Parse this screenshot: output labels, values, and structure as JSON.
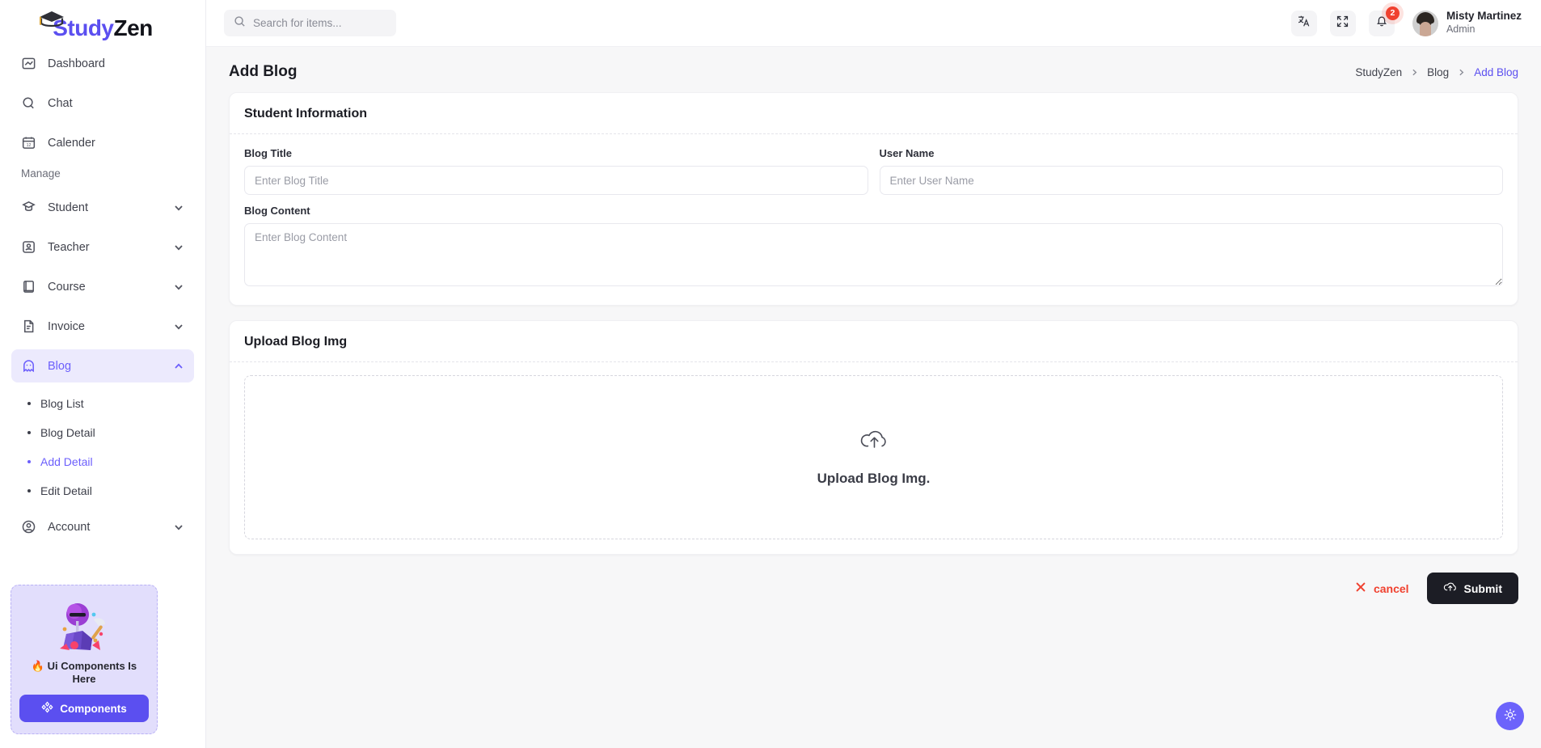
{
  "brand": {
    "part1": "Study",
    "part2": "Zen",
    "icon": "graduation-cap-icon"
  },
  "sidebar": {
    "items": [
      {
        "label": "Dashboard",
        "icon": "dashboard-icon",
        "expandable": false
      },
      {
        "label": "Chat",
        "icon": "chat-icon",
        "expandable": false
      },
      {
        "label": "Calender",
        "icon": "calendar-icon",
        "expandable": false
      }
    ],
    "section_label": "Manage",
    "manage_items": [
      {
        "label": "Student",
        "icon": "student-icon",
        "expandable": true
      },
      {
        "label": "Teacher",
        "icon": "teacher-icon",
        "expandable": true
      },
      {
        "label": "Course",
        "icon": "course-icon",
        "expandable": true
      },
      {
        "label": "Invoice",
        "icon": "invoice-icon",
        "expandable": true
      },
      {
        "label": "Blog",
        "icon": "ghost-icon",
        "expandable": true,
        "active": true,
        "expanded": true
      }
    ],
    "blog_children": [
      {
        "label": "Blog List"
      },
      {
        "label": "Blog Detail"
      },
      {
        "label": "Add Detail",
        "active": true
      },
      {
        "label": "Edit Detail"
      }
    ],
    "account_item": {
      "label": "Account",
      "icon": "account-circle-icon",
      "expandable": true
    },
    "promo": {
      "title": "🔥 Ui Components Is Here",
      "button_label": "Components",
      "button_icon": "components-icon",
      "art": "pickaxe-mining-illustration"
    }
  },
  "topbar": {
    "search": {
      "placeholder": "Search for items...",
      "value": "",
      "icon": "search-icon"
    },
    "language_icon": "translate-icon",
    "fullscreen_icon": "fullscreen-icon",
    "notification_icon": "bell-icon",
    "notification_count": "2",
    "user": {
      "name": "Misty Martinez",
      "role": "Admin",
      "avatar": "user-avatar"
    }
  },
  "page": {
    "title": "Add Blog",
    "breadcrumb": [
      {
        "label": "StudyZen",
        "current": false
      },
      {
        "label": "Blog",
        "current": false
      },
      {
        "label": "Add Blog",
        "current": true
      }
    ]
  },
  "student_information": {
    "card_title": "Student Information",
    "fields": [
      {
        "label": "Blog Title",
        "placeholder": "Enter Blog Title",
        "value": ""
      },
      {
        "label": "User Name",
        "placeholder": "Enter User Name",
        "value": ""
      }
    ],
    "content_field": {
      "label": "Blog Content",
      "placeholder": "Enter Blog Content",
      "value": ""
    }
  },
  "upload": {
    "card_title": "Upload Blog Img",
    "dropzone_label": "Upload Blog Img.",
    "dropzone_icon": "cloud-upload-icon"
  },
  "actions": {
    "cancel_label": "cancel",
    "cancel_icon": "close-x-icon",
    "submit_label": "Submit",
    "submit_icon": "cloud-upload-icon"
  },
  "fab": {
    "icon": "sun-icon"
  },
  "colors": {
    "accent": "#5b4ff0",
    "accent_soft": "#eceafd",
    "danger": "#f0412f",
    "dark": "#1c1d25",
    "page_bg": "#f7f7f8"
  }
}
